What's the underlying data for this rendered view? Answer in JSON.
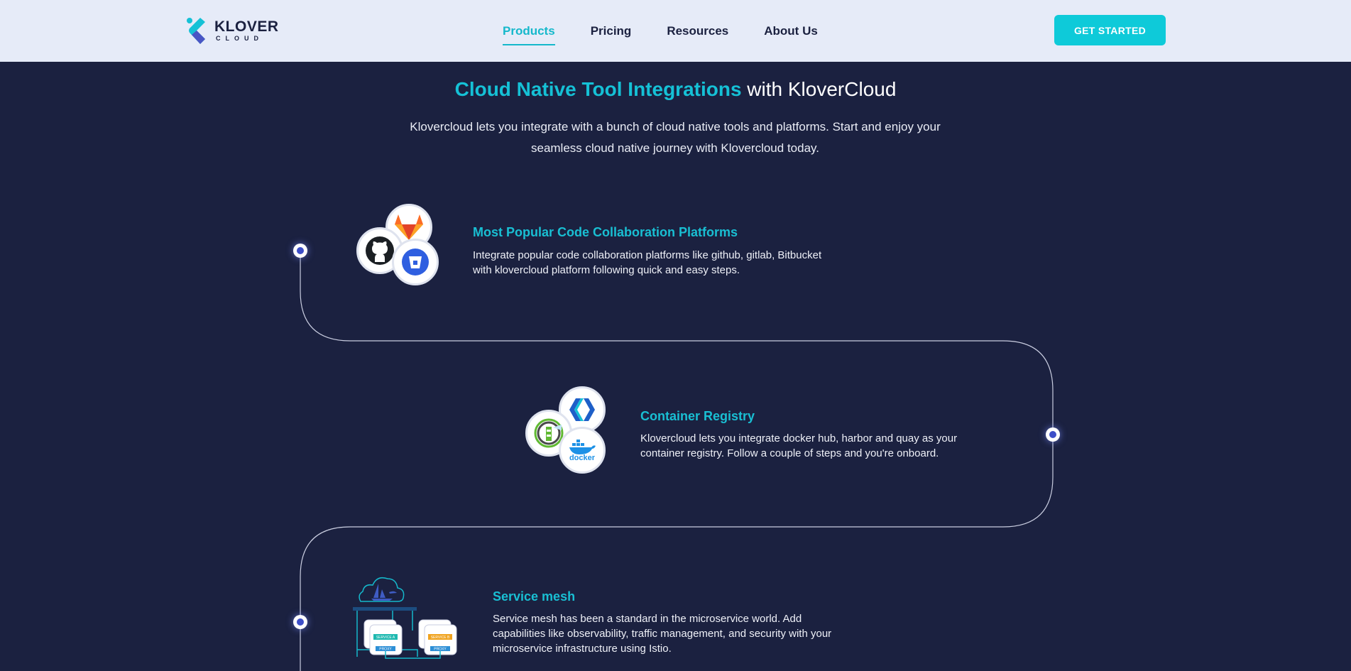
{
  "header": {
    "logo_word": "KLOVER",
    "logo_sub": "CLOUD",
    "nav": [
      {
        "label": "Products",
        "active": true
      },
      {
        "label": "Pricing",
        "active": false
      },
      {
        "label": "Resources",
        "active": false
      },
      {
        "label": "About Us",
        "active": false
      }
    ],
    "cta_label": "GET STARTED"
  },
  "hero": {
    "title_highlight": "Cloud Native Tool Integrations",
    "title_rest": " with KloverCloud",
    "subtitle": "Klovercloud lets you integrate with a bunch of cloud native tools and platforms. Start and enjoy your seamless cloud native journey with Klovercloud today."
  },
  "features": [
    {
      "title": "Most Popular Code Collaboration Platforms",
      "description": "Integrate popular code collaboration platforms like github, gitlab, Bitbucket with klovercloud platform following quick and easy steps.",
      "icons": [
        "github-icon",
        "gitlab-icon",
        "bitbucket-icon"
      ]
    },
    {
      "title": "Container Registry",
      "description": "Klovercloud lets you integrate docker hub, harbor and quay as your container registry. Follow a couple of steps and you're onboard.",
      "icons": [
        "klovercloud-icon",
        "harbor-icon",
        "docker-icon"
      ],
      "docker_label": "docker"
    },
    {
      "title": "Service mesh",
      "description": "Service mesh has been a standard in the microservice world. Add capabilities like observability, traffic management, and security with your microservice infrastructure using Istio.",
      "diagram_labels": [
        "SERVICE A",
        "SERVICE B",
        "PROXY",
        "PROXY"
      ]
    }
  ],
  "colors": {
    "background": "#1b2140",
    "header_bg": "#e6ebf8",
    "accent": "#15c1d6",
    "cta": "#0ecad9"
  }
}
